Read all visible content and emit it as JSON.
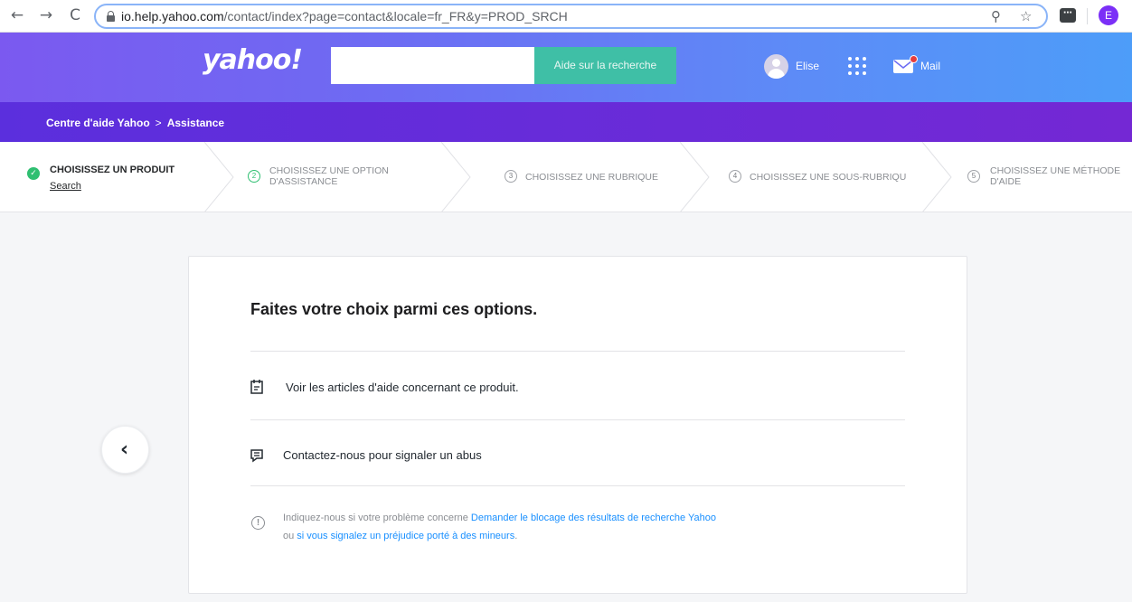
{
  "browser": {
    "url_host": "io.help.yahoo.com",
    "url_path": "/contact/index?page=contact&locale=fr_FR&y=PROD_SRCH",
    "profile_initial": "E"
  },
  "header": {
    "logo": "yahoo!",
    "search_placeholder": "",
    "search_button": "Aide sur la recherche",
    "user_name": "Elise",
    "mail_label": "Mail"
  },
  "breadcrumb": {
    "home": "Centre d'aide Yahoo",
    "separator": ">",
    "current": "Assistance"
  },
  "steps": [
    {
      "title": "CHOISISSEZ UN PRODUIT",
      "value": "Search",
      "status": "done"
    },
    {
      "number": "2",
      "line1": "CHOISISSEZ UNE OPTION",
      "line2": "D'ASSISTANCE",
      "status": "active"
    },
    {
      "number": "3",
      "line1": "CHOISISSEZ UNE RUBRIQUE",
      "status": "pending"
    },
    {
      "number": "4",
      "line1": "CHOISISSEZ UNE SOUS-RUBRIQU",
      "status": "pending"
    },
    {
      "number": "5",
      "line1": "CHOISISSEZ UNE MÉTHODE",
      "line2": "D'AIDE",
      "status": "pending"
    }
  ],
  "main": {
    "title": "Faites votre choix parmi ces options.",
    "options": [
      {
        "icon": "article-icon",
        "label": "Voir les articles d'aide concernant ce produit."
      },
      {
        "icon": "chat-icon",
        "label": "Contactez-nous pour signaler un abus"
      }
    ],
    "info": {
      "prefix": "Indiquez-nous si votre problème concerne ",
      "link1": "Demander le blocage des résultats de recherche Yahoo",
      "middle": " ou ",
      "link2": "si vous signalez un préjudice porté à des mineurs",
      "suffix": "."
    }
  },
  "colors": {
    "accent_green": "#3fbfa6",
    "step_done": "#2fbf71",
    "link_blue": "#188fff",
    "purple_bar": "#6a2bd8"
  }
}
